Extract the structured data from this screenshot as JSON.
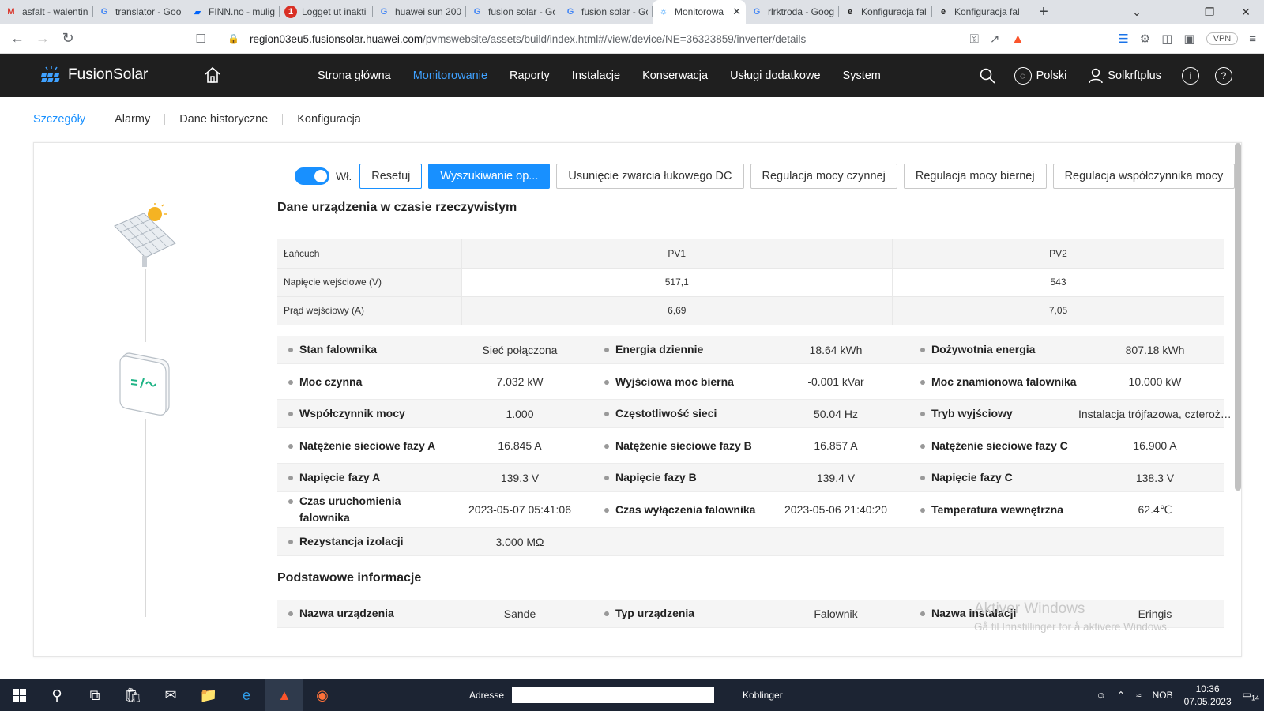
{
  "browser": {
    "tabs": [
      {
        "label": "asfalt - walentin",
        "icon": "gmail-icon",
        "icon_color": "#d93025"
      },
      {
        "label": "translator - Goo",
        "icon": "google-icon",
        "icon_color": "#4285f4"
      },
      {
        "label": "FINN.no - mulig",
        "icon": "finn-icon",
        "icon_color": "#0063fb"
      },
      {
        "label": "Logget ut inakti",
        "icon": "alert-icon",
        "icon_color": "#d93025"
      },
      {
        "label": "huawei sun 200",
        "icon": "google-icon",
        "icon_color": "#4285f4"
      },
      {
        "label": "fusion solar - Go",
        "icon": "google-icon",
        "icon_color": "#4285f4"
      },
      {
        "label": "fusion solar - Go",
        "icon": "google-icon",
        "icon_color": "#4285f4"
      },
      {
        "label": "Monitorowa",
        "icon": "fusionsolar-icon",
        "icon_color": "#1890ff",
        "active": true
      },
      {
        "label": "rlrktroda - Goog",
        "icon": "google-icon",
        "icon_color": "#4285f4"
      },
      {
        "label": "Konfiguracja fal",
        "icon": "edge-icon",
        "icon_color": "#222"
      },
      {
        "label": "Konfiguracja fal",
        "icon": "edge-icon",
        "icon_color": "#222"
      }
    ],
    "url_host": "region03eu5.fusionsolar.huawei.com",
    "url_path": "/pvmswebsite/assets/build/index.html#/view/device/NE=36323859/inverter/details",
    "vpn_label": "VPN"
  },
  "app": {
    "brand": "FusionSolar",
    "nav": [
      "Strona główna",
      "Monitorowanie",
      "Raporty",
      "Instalacje",
      "Konserwacja",
      "Usługi dodatkowe",
      "System"
    ],
    "active_nav": 1,
    "language": "Polski",
    "user": "Solkrftplus"
  },
  "subtabs": [
    "Szczegóły",
    "Alarmy",
    "Dane historyczne",
    "Konfiguracja"
  ],
  "actions": {
    "toggle_label": "Wł.",
    "reset": "Resetuj",
    "search": "Wyszukiwanie op...",
    "dc_arc": "Usunięcie zwarcia łukowego DC",
    "active_power": "Regulacja mocy czynnej",
    "reactive_power": "Regulacja mocy biernej",
    "power_factor": "Regulacja współczynnika mocy"
  },
  "realtime_title": "Dane urządzenia w czasie rzeczywistym",
  "pv_table": {
    "header": [
      "Łańcuch",
      "PV1",
      "PV2"
    ],
    "rows": [
      [
        "Napięcie wejściowe (V)",
        "517,1",
        "543"
      ],
      [
        "Prąd wejściowy (A)",
        "6,69",
        "7,05"
      ]
    ]
  },
  "realtime": [
    [
      [
        "Stan falownika",
        "Sieć połączona"
      ],
      [
        "Energia dziennie",
        "18.64 kWh"
      ],
      [
        "Dożywotnia energia",
        "807.18 kWh"
      ]
    ],
    [
      [
        "Moc czynna",
        "7.032 kW"
      ],
      [
        "Wyjściowa moc bierna",
        "-0.001 kVar"
      ],
      [
        "Moc znamionowa falownika",
        "10.000 kW"
      ]
    ],
    [
      [
        "Współczynnik mocy",
        "1.000"
      ],
      [
        "Częstotliwość sieci",
        "50.04 Hz"
      ],
      [
        "Tryb wyjściowy",
        "Instalacja trójfazowa, czteroży..."
      ]
    ],
    [
      [
        "Natężenie sieciowe fazy A",
        "16.845 A"
      ],
      [
        "Natężenie sieciowe fazy B",
        "16.857 A"
      ],
      [
        "Natężenie sieciowe fazy C",
        "16.900 A"
      ]
    ],
    [
      [
        "Napięcie fazy A",
        "139.3 V"
      ],
      [
        "Napięcie fazy B",
        "139.4 V"
      ],
      [
        "Napięcie fazy C",
        "138.3 V"
      ]
    ],
    [
      [
        "Czas uruchomienia falownika",
        "2023-05-07 05:41:06"
      ],
      [
        "Czas wyłączenia falownika",
        "2023-05-06 21:40:20"
      ],
      [
        "Temperatura wewnętrzna",
        "62.4℃"
      ]
    ],
    [
      [
        "Rezystancja izolacji",
        "3.000 MΩ"
      ]
    ]
  ],
  "basic_title": "Podstawowe informacje",
  "basic": [
    [
      [
        "Nazwa urządzenia",
        "Sande"
      ],
      [
        "Typ urządzenia",
        "Falownik"
      ],
      [
        "Nazwa instalacji",
        "Eringis"
      ]
    ]
  ],
  "watermark": {
    "line1": "Aktiver Windows",
    "line2": "Gå til Innstillinger for å aktivere Windows."
  },
  "taskbar": {
    "address_label": "Adresse",
    "links_label": "Koblinger",
    "lang": "NOB",
    "time": "10:36",
    "date": "07.05.2023",
    "notification_count": "14"
  }
}
